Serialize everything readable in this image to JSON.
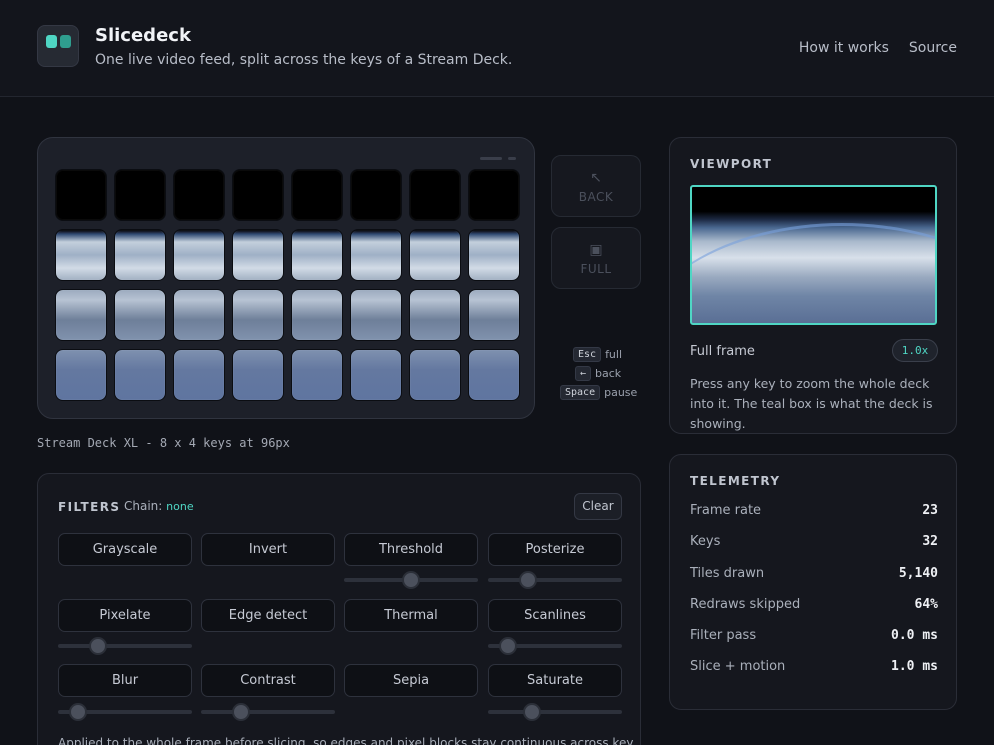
{
  "header": {
    "title": "Slicedeck",
    "subtitle": "One live video feed, split across the keys of a Stream Deck.",
    "nav": [
      "How it works",
      "Source"
    ]
  },
  "deck": {
    "caption": "Stream Deck XL - 8 x 4 keys at 96px",
    "columns": 8,
    "rows": 4,
    "side_buttons": {
      "back": "BACK",
      "full": "FULL"
    },
    "hints": [
      {
        "key": "Esc",
        "action": "full"
      },
      {
        "key": "←",
        "action": "back"
      },
      {
        "key": "Space",
        "action": "pause"
      }
    ]
  },
  "filters": {
    "title": "FILTERS",
    "chain_label": "Chain:",
    "chain_value": "none",
    "clear_label": "Clear",
    "buttons": [
      "Grayscale",
      "Invert",
      "Threshold",
      "Posterize",
      "Pixelate",
      "Edge detect",
      "Thermal",
      "Scanlines",
      "Blur",
      "Contrast",
      "Sepia",
      "Saturate"
    ],
    "sliders": {
      "threshold": 0.5,
      "posterize": 0.3,
      "pixelate": 0.3,
      "scanlines": 0.15,
      "blur": 0.15,
      "contrast": 0.3,
      "saturate": 0.33
    },
    "note": "Applied to the whole frame before slicing, so edges and pixel blocks stay continuous across key"
  },
  "viewport": {
    "title": "VIEWPORT",
    "label": "Full frame",
    "zoom": "1.0x",
    "description": "Press any key to zoom the whole deck into it. The teal box is what the deck is showing."
  },
  "telemetry": {
    "title": "TELEMETRY",
    "rows": [
      {
        "label": "Frame rate",
        "value": "23"
      },
      {
        "label": "Keys",
        "value": "32"
      },
      {
        "label": "Tiles drawn",
        "value": "5,140"
      },
      {
        "label": "Redraws skipped",
        "value": "64%"
      },
      {
        "label": "Filter pass",
        "value": "0.0 ms"
      },
      {
        "label": "Slice + motion",
        "value": "1.0 ms"
      }
    ]
  },
  "colors": {
    "accent": "#4fd6c4",
    "background": "#101218",
    "panel": "#15171e"
  }
}
